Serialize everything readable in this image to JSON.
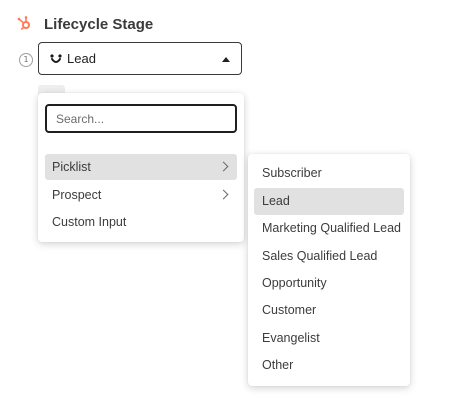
{
  "field": {
    "title": "Lifecycle Stage",
    "icon": "hubspot-sprocket-icon",
    "accent_color": "#ff7a59",
    "step_number": "1"
  },
  "select": {
    "value": "Lead",
    "value_icon": "integration-logo-icon"
  },
  "dropdown": {
    "search_placeholder": "Search...",
    "search_value": "",
    "items": [
      {
        "label": "Picklist",
        "has_submenu": true,
        "highlighted": true
      },
      {
        "label": "Prospect",
        "has_submenu": true,
        "highlighted": false
      },
      {
        "label": "Custom Input",
        "has_submenu": false,
        "highlighted": false
      }
    ]
  },
  "submenu": {
    "items": [
      {
        "label": "Subscriber",
        "selected": false
      },
      {
        "label": "Lead",
        "selected": true
      },
      {
        "label": "Marketing Qualified Lead",
        "selected": false
      },
      {
        "label": "Sales Qualified Lead",
        "selected": false
      },
      {
        "label": "Opportunity",
        "selected": false
      },
      {
        "label": "Customer",
        "selected": false
      },
      {
        "label": "Evangelist",
        "selected": false
      },
      {
        "label": "Other",
        "selected": false
      }
    ]
  }
}
